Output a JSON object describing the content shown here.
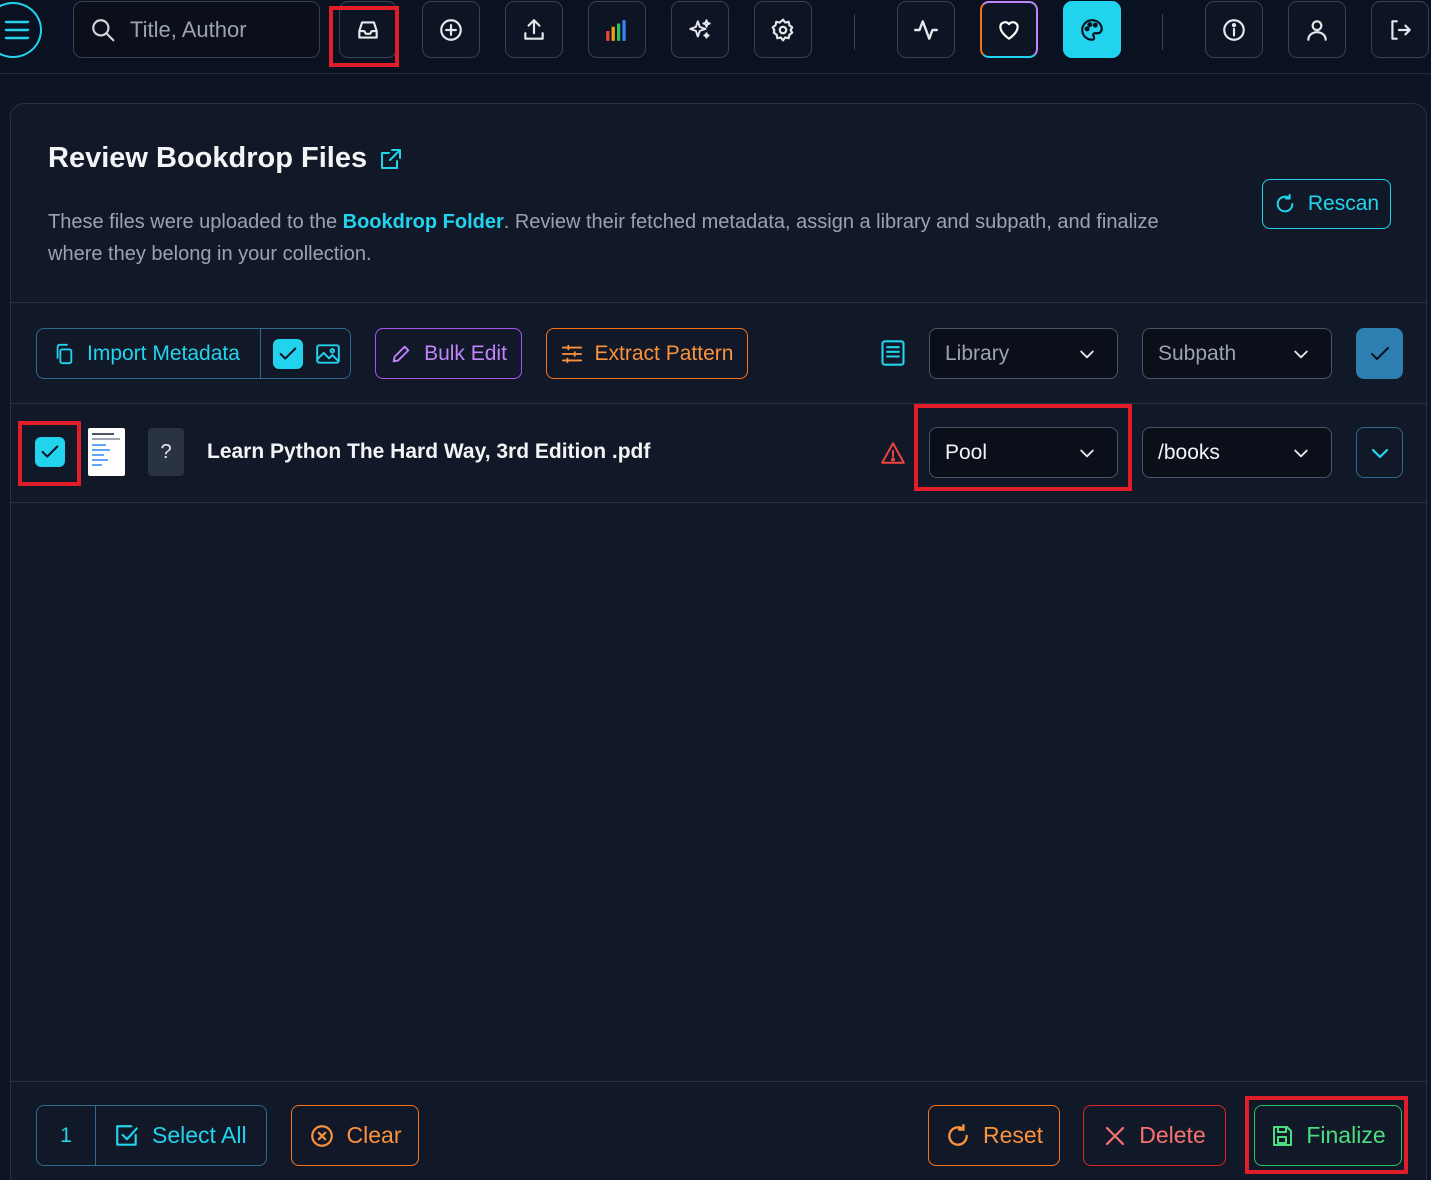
{
  "topbar": {
    "search_placeholder": "Title, Author",
    "buttons": [
      {
        "icon": "inbox-icon",
        "label": "Bookdrop"
      },
      {
        "icon": "plus-circle-icon",
        "label": "Add"
      },
      {
        "icon": "upload-icon",
        "label": "Upload"
      },
      {
        "icon": "bar-chart-icon",
        "label": "Stats"
      },
      {
        "icon": "sparkles-icon",
        "label": "Magic"
      },
      {
        "icon": "gear-icon",
        "label": "Settings"
      },
      {
        "icon": "activity-icon",
        "label": "Activity"
      },
      {
        "icon": "heart-icon",
        "label": "Favorites"
      },
      {
        "icon": "palette-icon",
        "label": "Theme"
      },
      {
        "icon": "info-icon",
        "label": "About"
      },
      {
        "icon": "user-icon",
        "label": "Profile"
      },
      {
        "icon": "logout-icon",
        "label": "Logout"
      }
    ],
    "accent": "#22d3ee"
  },
  "page": {
    "title": "Review Bookdrop Files",
    "desc_before": "These files were uploaded to the ",
    "desc_link": "Bookdrop Folder",
    "desc_after": ". Review their fetched metadata, assign a library and subpath, and finalize where they belong in your collection.",
    "rescan_label": "Rescan"
  },
  "toolbar": {
    "import_label": "Import Metadata",
    "import_checked": true,
    "bulk_edit_label": "Bulk Edit",
    "extract_label": "Extract Pattern",
    "library_placeholder": "Library",
    "subpath_placeholder": "Subpath"
  },
  "files": [
    {
      "checked": true,
      "cover": "?",
      "name": "Learn Python The Hard Way, 3rd Edition .pdf",
      "warning": true,
      "library": "Pool",
      "subpath": "/books"
    }
  ],
  "footer": {
    "selected_count": "1",
    "select_all_label": "Select All",
    "clear_label": "Clear",
    "reset_label": "Reset",
    "delete_label": "Delete",
    "finalize_label": "Finalize"
  },
  "colors": {
    "cyan": "#22d3ee",
    "purple": "#c084fc",
    "orange": "#fb923c",
    "red": "#f87171",
    "green": "#4ade80",
    "highlight": "#e11d2a"
  }
}
